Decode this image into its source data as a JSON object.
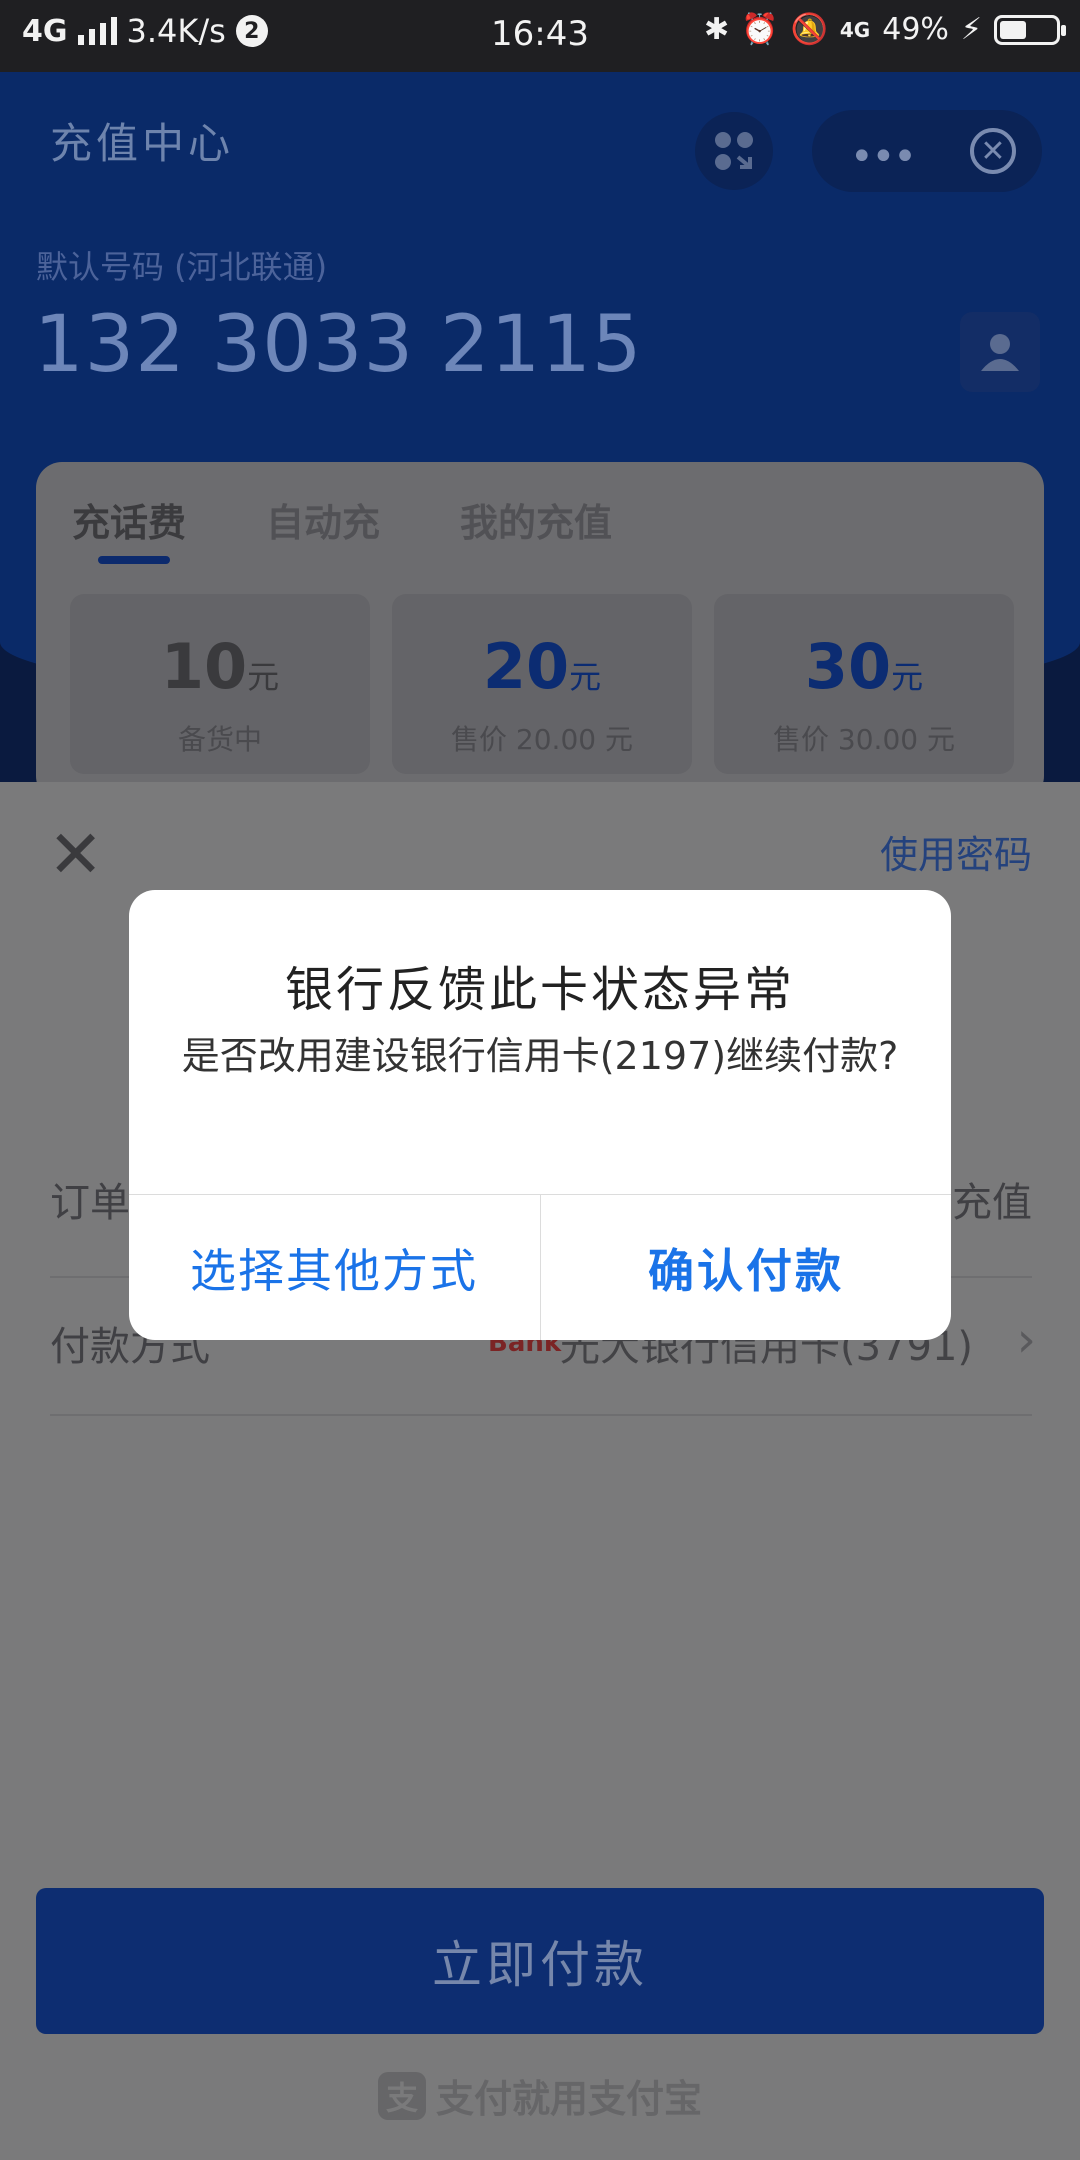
{
  "status_bar": {
    "network": "4G",
    "speed": "3.4K/s",
    "notification_count": "2",
    "time": "16:43",
    "mobile_data": "4G",
    "battery_percent": "49%",
    "battery_level": 0.49
  },
  "header": {
    "title": "充值中心",
    "default_number_label": "默认号码 (河北联通)",
    "phone_number": "132 3033 2115"
  },
  "recharge_card": {
    "tabs": [
      "充话费",
      "自动充",
      "我的充值"
    ],
    "amounts": [
      {
        "value": "10",
        "unit": "元",
        "sub": "备货中"
      },
      {
        "value": "20",
        "unit": "元",
        "sub": "售价 20.00 元"
      },
      {
        "value": "30",
        "unit": "元",
        "sub": "售价 30.00 元"
      }
    ]
  },
  "payment_sheet": {
    "use_password": "使用密码",
    "order_label": "订单",
    "order_value_tail": "充值",
    "payment_method_label": "付款方式",
    "bank_logo_text": "Bank",
    "bank_name": "光大银行信用卡(3791)",
    "pay_button": "立即付款",
    "footer": "支付就用支付宝",
    "footer_logo": "支"
  },
  "dialog": {
    "title": "银行反馈此卡状态异常",
    "message": "是否改用建设银行信用卡(2197)继续付款?",
    "cancel_label": "选择其他方式",
    "confirm_label": "确认付款"
  },
  "colors": {
    "accent": "#1a73e8",
    "dim_overlay": "#000000"
  }
}
